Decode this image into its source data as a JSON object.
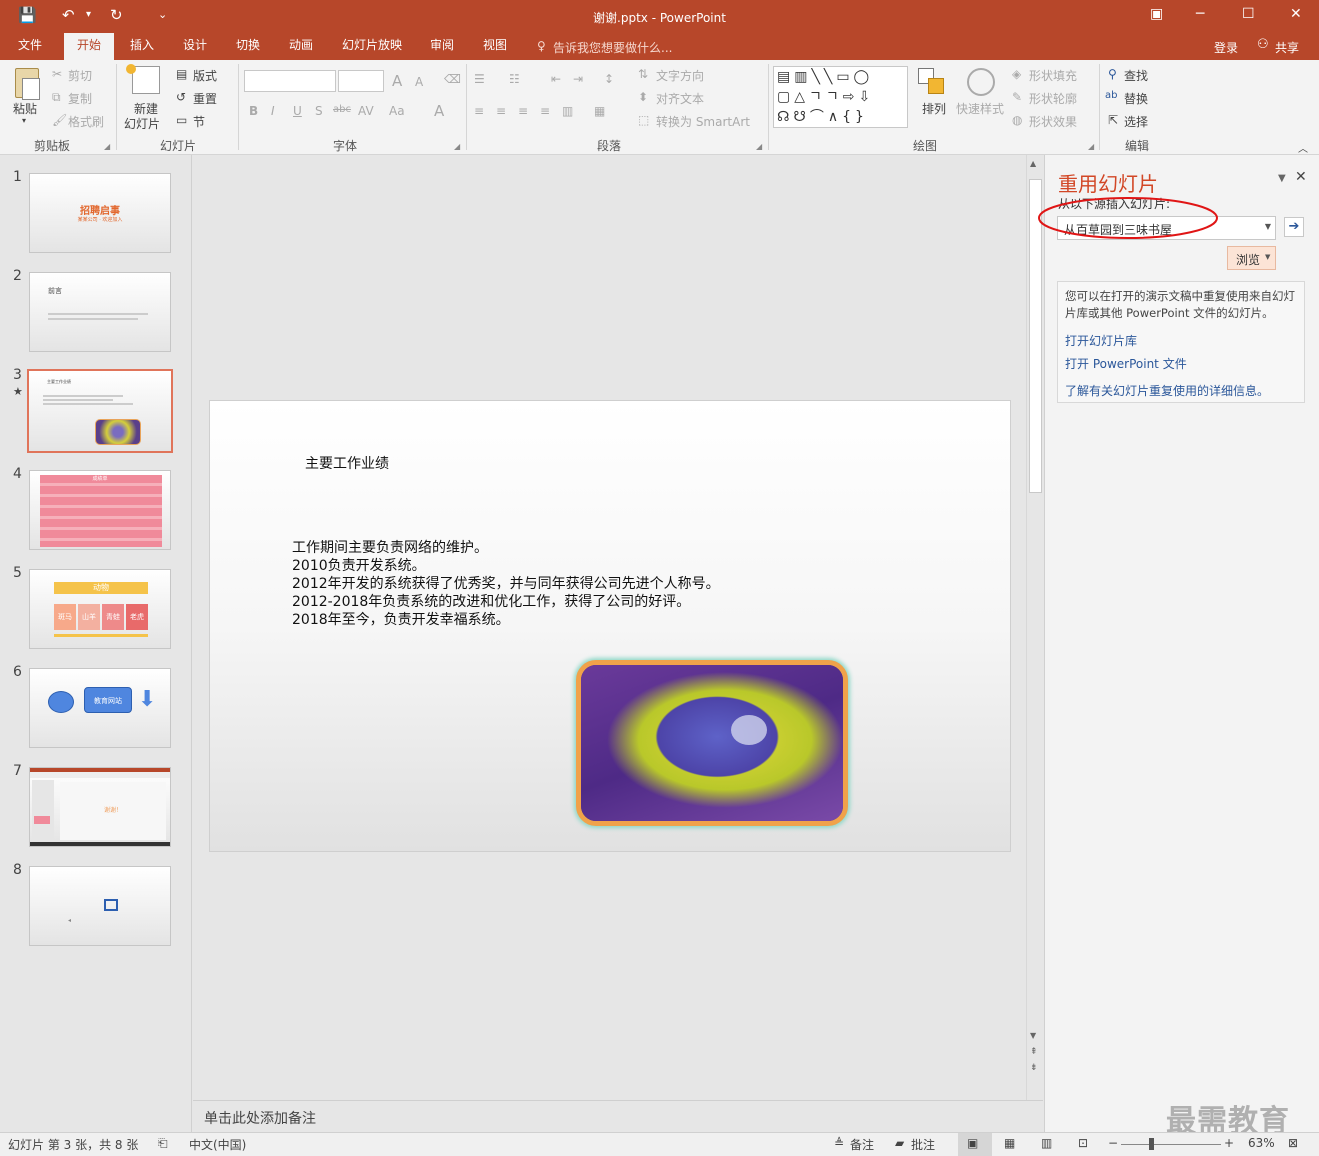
{
  "window": {
    "title": "谢谢.pptx - PowerPoint"
  },
  "qat": {
    "save": "💾",
    "undo": "↶",
    "redo": "↻",
    "customize": "⌄"
  },
  "tabs": [
    {
      "label": "文件"
    },
    {
      "label": "开始"
    },
    {
      "label": "插入"
    },
    {
      "label": "设计"
    },
    {
      "label": "切换"
    },
    {
      "label": "动画"
    },
    {
      "label": "幻灯片放映"
    },
    {
      "label": "审阅"
    },
    {
      "label": "视图"
    }
  ],
  "tellme": "告诉我您想要做什么...",
  "account": {
    "signin": "登录",
    "share": "共享"
  },
  "ribbon": {
    "clipboard": {
      "label": "剪贴板",
      "paste": "粘贴",
      "cut": "剪切",
      "copy": "复制",
      "format_painter": "格式刷"
    },
    "slides": {
      "label": "幻灯片",
      "new_slide": "新建",
      "new_slide2": "幻灯片",
      "layout": "版式",
      "reset": "重置",
      "section": "节"
    },
    "font": {
      "label": "字体",
      "bold": "B",
      "italic": "I",
      "underline": "U",
      "shadow": "S",
      "strike": "abc",
      "spacing": "AV",
      "case": "Aa",
      "color": "A",
      "grow": "A",
      "shrink": "A"
    },
    "paragraph": {
      "label": "段落",
      "text_direction": "文字方向",
      "align_text": "对齐文本",
      "smartart": "转换为 SmartArt"
    },
    "drawing": {
      "label": "绘图",
      "arrange": "排列",
      "quick_styles": "快速样式",
      "shape_fill": "形状填充",
      "shape_outline": "形状轮廓",
      "shape_effects": "形状效果"
    },
    "editing": {
      "label": "编辑",
      "find": "查找",
      "replace": "替换",
      "select": "选择"
    }
  },
  "thumbnails": [
    {
      "num": "1",
      "title": "招聘启事",
      "sub": "某某公司 · 欢迎加入"
    },
    {
      "num": "2",
      "title": "前言"
    },
    {
      "num": "3",
      "title": "主要工作业绩"
    },
    {
      "num": "4",
      "title": "成绩单"
    },
    {
      "num": "5",
      "title": "动物",
      "cells": [
        "斑马",
        "山羊",
        "青蛙",
        "老虎"
      ]
    },
    {
      "num": "6",
      "label": "教育网站"
    },
    {
      "num": "7",
      "label": "谢谢！"
    },
    {
      "num": "8"
    }
  ],
  "slide": {
    "title": "主要工作业绩",
    "lines": [
      "工作期间主要负责网络的维护。",
      "2010负责开发系统。",
      "2012年开发的系统获得了优秀奖，并与同年获得公司先进个人称号。",
      "2012-2018年负责系统的改进和优化工作，获得了公司的好评。",
      "2018年至今，负责开发幸福系统。"
    ]
  },
  "notes_placeholder": "单击此处添加备注",
  "reuse_pane": {
    "title": "重用幻灯片",
    "source_label": "从以下源插入幻灯片:",
    "source_value": "从百草园到三味书屋",
    "browse": "浏览",
    "info": "您可以在打开的演示文稿中重复使用来自幻灯片库或其他 PowerPoint 文件的幻灯片。",
    "link1": "打开幻灯片库",
    "link2": "打开 PowerPoint 文件",
    "link3": "了解有关幻灯片重复使用的详细信息。"
  },
  "status": {
    "slide_info": "幻灯片 第 3 张，共 8 张",
    "language": "中文(中国)",
    "notes": "备注",
    "comments": "批注",
    "zoom": "63%"
  },
  "watermark": "最需教育",
  "colors": {
    "accent": "#b7472a",
    "link": "#2b579a",
    "annotation": "#e01515"
  }
}
